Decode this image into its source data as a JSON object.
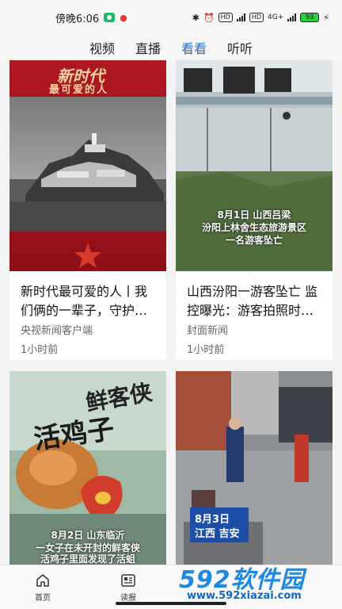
{
  "status_bar": {
    "time": "傍晚6:06",
    "hd1": "HD",
    "hd2": "HD",
    "net": "4G+",
    "battery": "93"
  },
  "top_tabs": [
    {
      "label": "视频"
    },
    {
      "label": "直播"
    },
    {
      "label": "看看"
    },
    {
      "label": "听听"
    }
  ],
  "cards": [
    {
      "title": "新时代最可爱的人丨我们俩的一辈子，守护这座小岛",
      "source": "央视新闻客户端",
      "time": "1小时前",
      "overlay_top": "新时代",
      "overlay_sub": "最可爱的人"
    },
    {
      "title": "山西汾阳一游客坠亡 监控曝光：游客拍照时坠落",
      "source": "封面新闻",
      "time": "1小时前",
      "overlay_lines": [
        "8月1日 山西吕梁",
        "汾阳上林舍生态旅游景区",
        "一名游客坠亡"
      ]
    },
    {
      "overlay_lines": [
        "8月2日 山东临沂",
        "一女子在未开封的鲜客侠",
        "活鸡子里面发现了活蛆"
      ],
      "package_text": "鲜客侠",
      "package_text2": "活鸡子"
    },
    {
      "overlay_date": "8月3日",
      "overlay_place": "江西 吉安"
    }
  ],
  "bottom_nav": [
    {
      "label": "首页",
      "icon": "home-icon"
    },
    {
      "label": "读报",
      "icon": "newspaper-icon"
    }
  ],
  "watermark": {
    "brand": "592软件园",
    "url": "www.592xiazai.com"
  },
  "colors": {
    "accent": "#2a6fd6",
    "watermark": "#1e88e5"
  }
}
